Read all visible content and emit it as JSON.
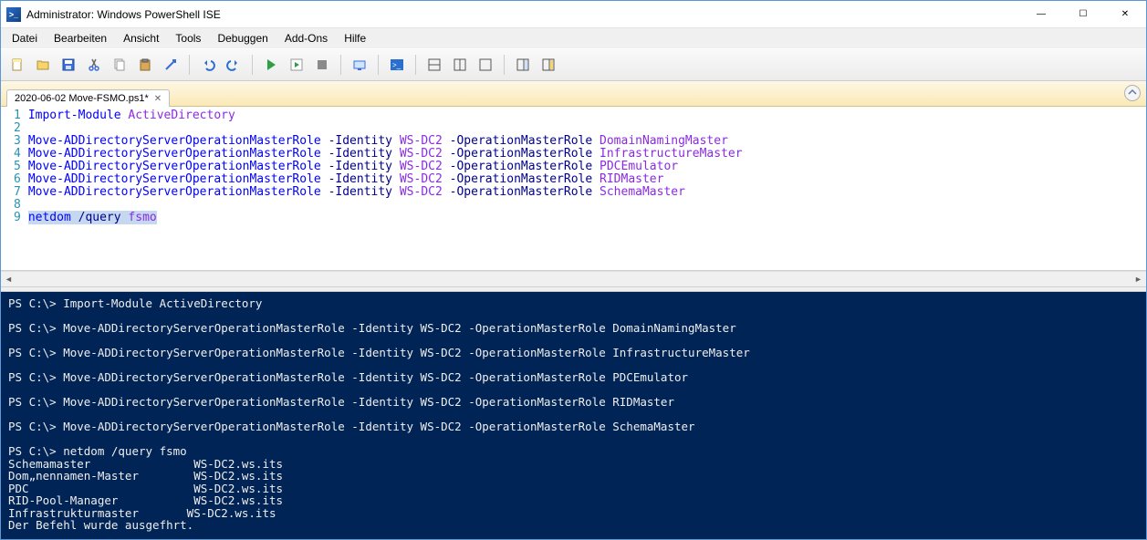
{
  "window": {
    "title": "Administrator: Windows PowerShell ISE"
  },
  "menu": {
    "items": [
      "Datei",
      "Bearbeiten",
      "Ansicht",
      "Tools",
      "Debuggen",
      "Add-Ons",
      "Hilfe"
    ]
  },
  "tab": {
    "label": "2020-06-02 Move-FSMO.ps1*",
    "close": "✕"
  },
  "code_lines": [
    {
      "n": "1",
      "tokens": [
        [
          "cmd",
          "Import-Module"
        ],
        [
          "sp",
          " "
        ],
        [
          "arg",
          "ActiveDirectory"
        ]
      ]
    },
    {
      "n": "2",
      "tokens": []
    },
    {
      "n": "3",
      "tokens": [
        [
          "cmd",
          "Move-ADDirectoryServerOperationMasterRole"
        ],
        [
          "sp",
          " "
        ],
        [
          "param",
          "-Identity"
        ],
        [
          "sp",
          " "
        ],
        [
          "arg",
          "WS-DC2"
        ],
        [
          "sp",
          " "
        ],
        [
          "param",
          "-OperationMasterRole"
        ],
        [
          "sp",
          " "
        ],
        [
          "arg",
          "DomainNamingMaster"
        ]
      ]
    },
    {
      "n": "4",
      "tokens": [
        [
          "cmd",
          "Move-ADDirectoryServerOperationMasterRole"
        ],
        [
          "sp",
          " "
        ],
        [
          "param",
          "-Identity"
        ],
        [
          "sp",
          " "
        ],
        [
          "arg",
          "WS-DC2"
        ],
        [
          "sp",
          " "
        ],
        [
          "param",
          "-OperationMasterRole"
        ],
        [
          "sp",
          " "
        ],
        [
          "arg",
          "InfrastructureMaster"
        ]
      ]
    },
    {
      "n": "5",
      "tokens": [
        [
          "cmd",
          "Move-ADDirectoryServerOperationMasterRole"
        ],
        [
          "sp",
          " "
        ],
        [
          "param",
          "-Identity"
        ],
        [
          "sp",
          " "
        ],
        [
          "arg",
          "WS-DC2"
        ],
        [
          "sp",
          " "
        ],
        [
          "param",
          "-OperationMasterRole"
        ],
        [
          "sp",
          " "
        ],
        [
          "arg",
          "PDCEmulator"
        ]
      ]
    },
    {
      "n": "6",
      "tokens": [
        [
          "cmd",
          "Move-ADDirectoryServerOperationMasterRole"
        ],
        [
          "sp",
          " "
        ],
        [
          "param",
          "-Identity"
        ],
        [
          "sp",
          " "
        ],
        [
          "arg",
          "WS-DC2"
        ],
        [
          "sp",
          " "
        ],
        [
          "param",
          "-OperationMasterRole"
        ],
        [
          "sp",
          " "
        ],
        [
          "arg",
          "RIDMaster"
        ]
      ]
    },
    {
      "n": "7",
      "tokens": [
        [
          "cmd",
          "Move-ADDirectoryServerOperationMasterRole"
        ],
        [
          "sp",
          " "
        ],
        [
          "param",
          "-Identity"
        ],
        [
          "sp",
          " "
        ],
        [
          "arg",
          "WS-DC2"
        ],
        [
          "sp",
          " "
        ],
        [
          "param",
          "-OperationMasterRole"
        ],
        [
          "sp",
          " "
        ],
        [
          "arg",
          "SchemaMaster"
        ]
      ]
    },
    {
      "n": "8",
      "tokens": []
    },
    {
      "n": "9",
      "selected": true,
      "tokens": [
        [
          "cmd",
          "netdom"
        ],
        [
          "sp",
          " "
        ],
        [
          "param",
          "/query"
        ],
        [
          "sp",
          " "
        ],
        [
          "arg",
          "fsmo"
        ]
      ]
    }
  ],
  "console_lines": [
    "PS C:\\> Import-Module ActiveDirectory",
    "",
    "PS C:\\> Move-ADDirectoryServerOperationMasterRole -Identity WS-DC2 -OperationMasterRole DomainNamingMaster",
    "",
    "PS C:\\> Move-ADDirectoryServerOperationMasterRole -Identity WS-DC2 -OperationMasterRole InfrastructureMaster",
    "",
    "PS C:\\> Move-ADDirectoryServerOperationMasterRole -Identity WS-DC2 -OperationMasterRole PDCEmulator",
    "",
    "PS C:\\> Move-ADDirectoryServerOperationMasterRole -Identity WS-DC2 -OperationMasterRole RIDMaster",
    "",
    "PS C:\\> Move-ADDirectoryServerOperationMasterRole -Identity WS-DC2 -OperationMasterRole SchemaMaster",
    "",
    "PS C:\\> netdom /query fsmo",
    "Schemamaster               WS-DC2.ws.its",
    "Dom„nennamen-Master        WS-DC2.ws.its",
    "PDC                        WS-DC2.ws.its",
    "RID-Pool-Manager           WS-DC2.ws.its",
    "Infrastrukturmaster       WS-DC2.ws.its",
    "Der Befehl wurde ausgefhrt.",
    ""
  ],
  "toolbar_icons": [
    "new-file-icon",
    "open-file-icon",
    "save-icon",
    "cut-icon",
    "copy-icon",
    "paste-icon",
    "clear-icon",
    "sep",
    "undo-icon",
    "redo-icon",
    "sep",
    "run-script-icon",
    "run-selection-icon",
    "stop-icon",
    "sep",
    "remote-icon",
    "sep",
    "powershell-icon",
    "sep",
    "layout-horizontal-icon",
    "layout-vertical-icon",
    "layout-full-icon",
    "sep",
    "show-command-icon",
    "show-addon-icon"
  ]
}
